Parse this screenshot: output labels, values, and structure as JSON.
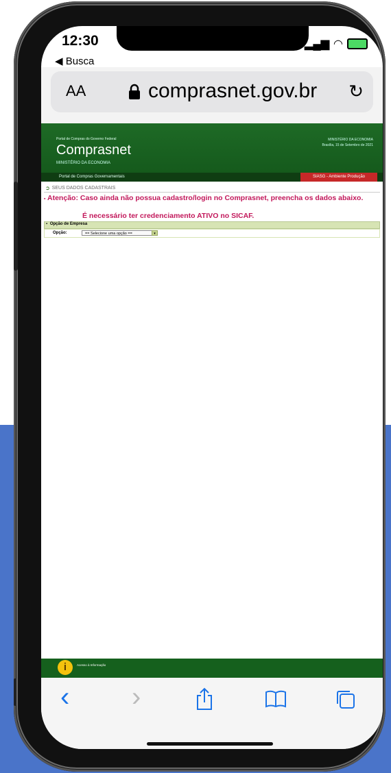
{
  "status_bar": {
    "time": "12:30",
    "back_label": "◀ Busca"
  },
  "url_bar": {
    "text_size_label": "AA",
    "url": "comprasnet.gov.br"
  },
  "site": {
    "subtitle": "Portal de Compras do Governo Federal",
    "title": "Comprasnet",
    "ministry": "MINISTÉRIO DA ECONOMIA",
    "right_line1": "MINISTÉRIO DA ECONOMIA",
    "right_line2": "Brasília, 15 de Setembro de 2021",
    "nav_label": "Portal de Compras Governamentais",
    "env_badge": "SIASG - Ambiente Produção",
    "section_title": "SEUS DADOS CADASTRAIS",
    "warning_text": "Atenção: Caso ainda não possua cadastro/login no Comprasnet, preencha os dados abaixo.",
    "warning_required": "É necessário ter credenciamento ATIVO no SICAF.",
    "form_header": "Opção de Empresa",
    "option_label": "Opção:",
    "option_select_value": "== Selecione uma opção ==",
    "footer_info_label": "Acesso à Informação"
  },
  "toolbar": {
    "back_icon": "‹",
    "forward_icon": "›",
    "share_icon": "share-icon",
    "bookmarks_icon": "book-icon",
    "tabs_icon": "tabs-icon"
  },
  "colors": {
    "site_green": "#1e6a26",
    "warning": "#c2185b",
    "accent": "#1a73e8",
    "background_blue": "#4a74c9"
  }
}
